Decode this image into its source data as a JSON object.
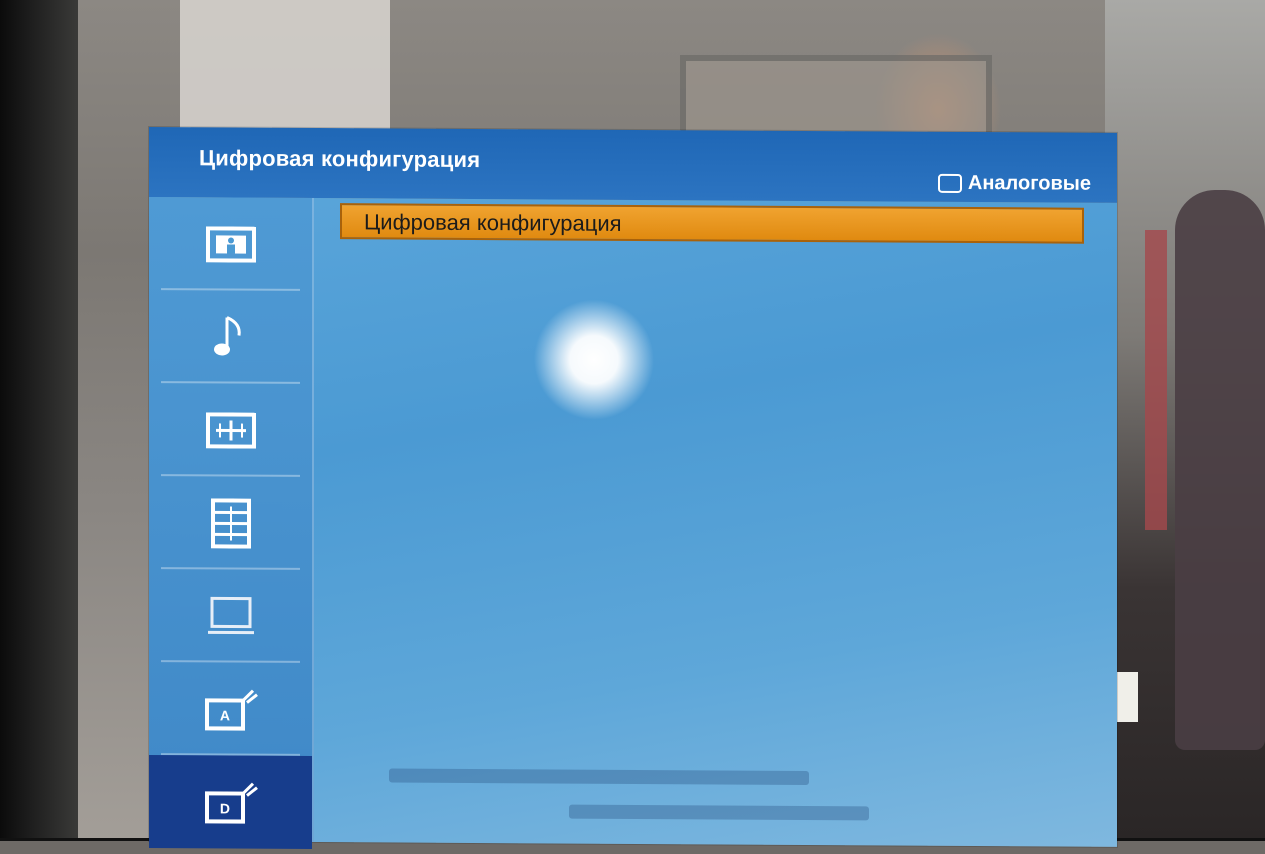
{
  "osd": {
    "title": "Цифровая конфигурация",
    "analog_button_label": "Аналоговые",
    "selected_item_label": "Цифровая конфигурация"
  },
  "sidebar": {
    "items": [
      {
        "name": "picture",
        "icon": "picture-icon"
      },
      {
        "name": "sound",
        "icon": "music-note-icon"
      },
      {
        "name": "setup",
        "icon": "grid-settings-icon"
      },
      {
        "name": "timer",
        "icon": "table-icon"
      },
      {
        "name": "screen",
        "icon": "blank-screen-icon"
      },
      {
        "name": "analog-tuning",
        "icon": "antenna-a-icon",
        "letter": "A"
      },
      {
        "name": "digital-tuning",
        "icon": "antenna-d-icon",
        "letter": "D",
        "active": true
      }
    ]
  },
  "colors": {
    "header": "#1f67b6",
    "body": "#4b9ad3",
    "highlight": "#e08a10",
    "active_sidebar": "#173d8c"
  }
}
